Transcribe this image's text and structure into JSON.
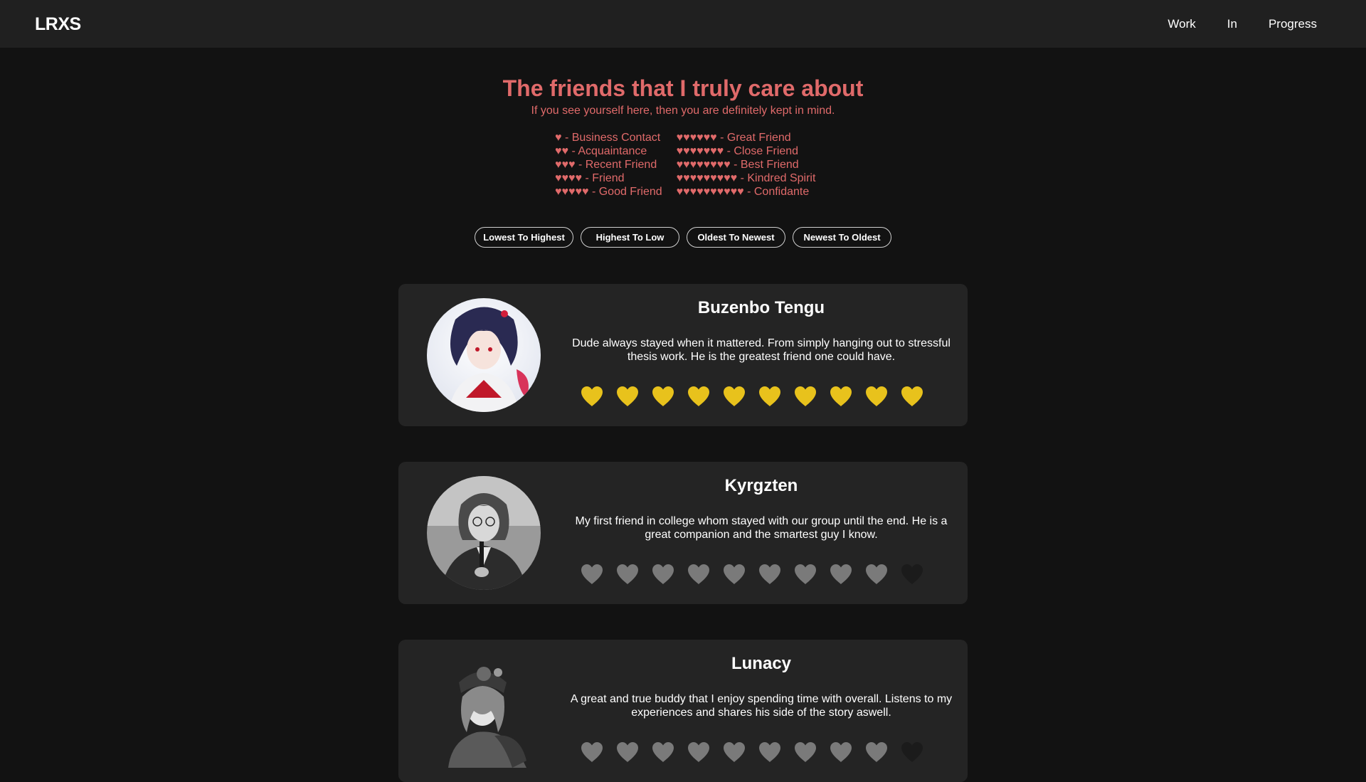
{
  "header": {
    "logo": "LRXS",
    "nav": [
      "Work",
      "In",
      "Progress"
    ]
  },
  "intro": {
    "title": "The friends that I truly care about",
    "subtitle": "If you see yourself here, then you are definitely kept in mind."
  },
  "legend": {
    "left": [
      "♥ - Business Contact",
      "♥♥ - Acquaintance",
      "♥♥♥ - Recent Friend",
      "♥♥♥♥ - Friend",
      "♥♥♥♥♥ - Good Friend"
    ],
    "right": [
      "♥♥♥♥♥♥ - Great Friend",
      "♥♥♥♥♥♥♥ - Close Friend",
      "♥♥♥♥♥♥♥♥ - Best Friend",
      "♥♥♥♥♥♥♥♥♥ - Kindred Spirit",
      "♥♥♥♥♥♥♥♥♥♥ - Confidante"
    ]
  },
  "sort_buttons": [
    "Lowest To Highest",
    "Highest To Low",
    "Oldest To Newest",
    "Newest To Oldest"
  ],
  "colors": {
    "accent": "#e06a6a",
    "heart_gold": "#e8c21c",
    "heart_gray": "#7a7a7a",
    "heart_empty": "#1b1b1b"
  },
  "friends": [
    {
      "name": "Buzenbo Tengu",
      "description": "Dude always stayed when it mattered. From simply hanging out to stressful thesis work. He is the greatest friend one could have.",
      "avatar": "anime-character-portrait",
      "rating": 10,
      "max_rating": 10,
      "highlighted": true
    },
    {
      "name": "Kyrgzten",
      "description": "My first friend in college whom stayed with our group until the end. He is a great companion and the smartest guy I know.",
      "avatar": "person-photo-grayscale",
      "rating": 9,
      "max_rating": 10,
      "highlighted": false
    },
    {
      "name": "Lunacy",
      "description": "A great and true buddy that I enjoy spending time with overall. Listens to my experiences and shares his side of the story aswell.",
      "avatar": "anime-character-grayscale",
      "rating": 9,
      "max_rating": 10,
      "highlighted": false
    }
  ]
}
